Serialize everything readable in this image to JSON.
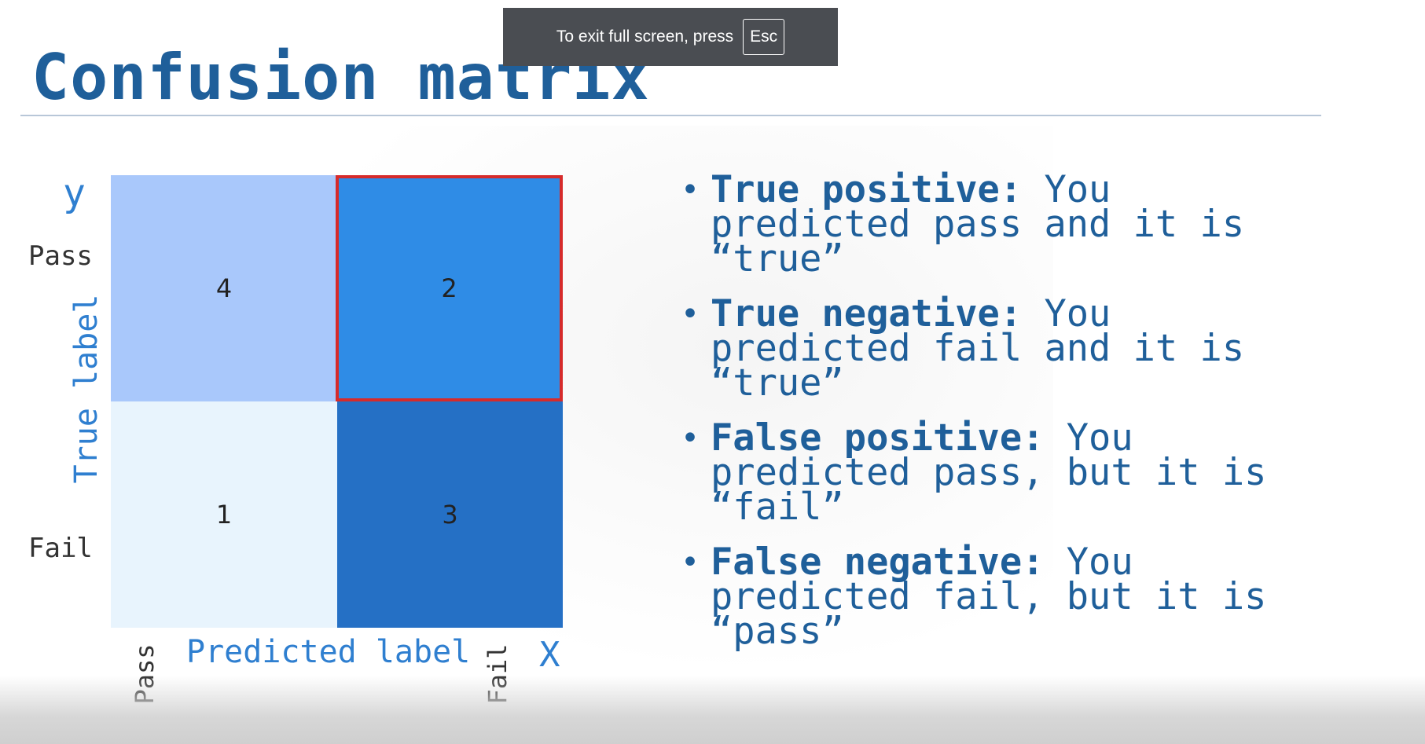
{
  "fullscreen_toast": {
    "message": "To exit full screen, press",
    "key": "Esc"
  },
  "slide": {
    "title": "Confusion matrix"
  },
  "matrix": {
    "y_symbol": "y",
    "x_symbol": "X",
    "y_axis_title": "True label",
    "x_axis_title": "Predicted label",
    "y_ticks": [
      "Pass",
      "Fail"
    ],
    "x_ticks": [
      "Pass",
      "Fail"
    ],
    "cells": [
      "4",
      "2",
      "1",
      "3"
    ],
    "colors": {
      "top_left": "#a9c8fb",
      "top_right": "#2f8ce6",
      "bottom_left": "#e8f4fd",
      "bottom_right": "#2570c5",
      "highlight_border": "#d62b2b"
    }
  },
  "bullets": [
    {
      "term": "True positive:",
      "text": " You predicted pass and it is “true”"
    },
    {
      "term": "True negative:",
      "text": " You predicted fail and it is “true”"
    },
    {
      "term": "False positive:",
      "text": " You predicted pass, but it is “fail”"
    },
    {
      "term": "False negative:",
      "text": " You predicted fail, but it is “pass”"
    }
  ],
  "accent_color": "#1f5f9a"
}
